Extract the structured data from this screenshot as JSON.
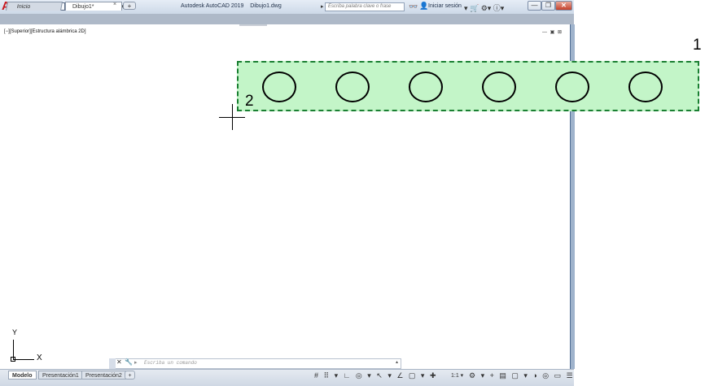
{
  "titlebar": {
    "app_logo": "A",
    "app_name": "Autodesk AutoCAD 2019",
    "document_name": "Dibujo1.dwg",
    "search_placeholder": "Escriba palabra clave o frase",
    "signin_label": "Iniciar sesión",
    "qa_arrows": "↶ ▾ ↷ ▾ ▾",
    "right_icons": "▾ 🛒 ⚙▾ ⓘ▾",
    "minimize": "—",
    "restore": "❐",
    "close": "✕"
  },
  "tabs": {
    "start": "Inicio",
    "current": "Dibujo1*",
    "close": "×",
    "add": "+"
  },
  "viewport": {
    "label": "[−][Superior][Estructura alámbrica 2D]",
    "controls": "— ▣ ⊠"
  },
  "callouts": {
    "first": "1",
    "second": "2"
  },
  "drawing": {
    "circle_count": 6,
    "selection_fill": "#c3f5c8",
    "selection_border": "#1a7f32"
  },
  "ucs": {
    "x_label": "X",
    "y_label": "Y"
  },
  "command_line": {
    "close": "✕",
    "settings": "🔧",
    "prompt": "▸",
    "placeholder": "Escriba un comando",
    "arrow": "▴"
  },
  "layout_tabs": {
    "model": "Modelo",
    "layout1": "Presentación1",
    "layout2": "Presentación2",
    "add": "+"
  },
  "statusbar": {
    "icons": "# ⠿ ▾ ∟ ◎ ▾ ↖ ▾ ∠ ▢ ▾ ✚",
    "scale": "1:1 ▾"
  }
}
